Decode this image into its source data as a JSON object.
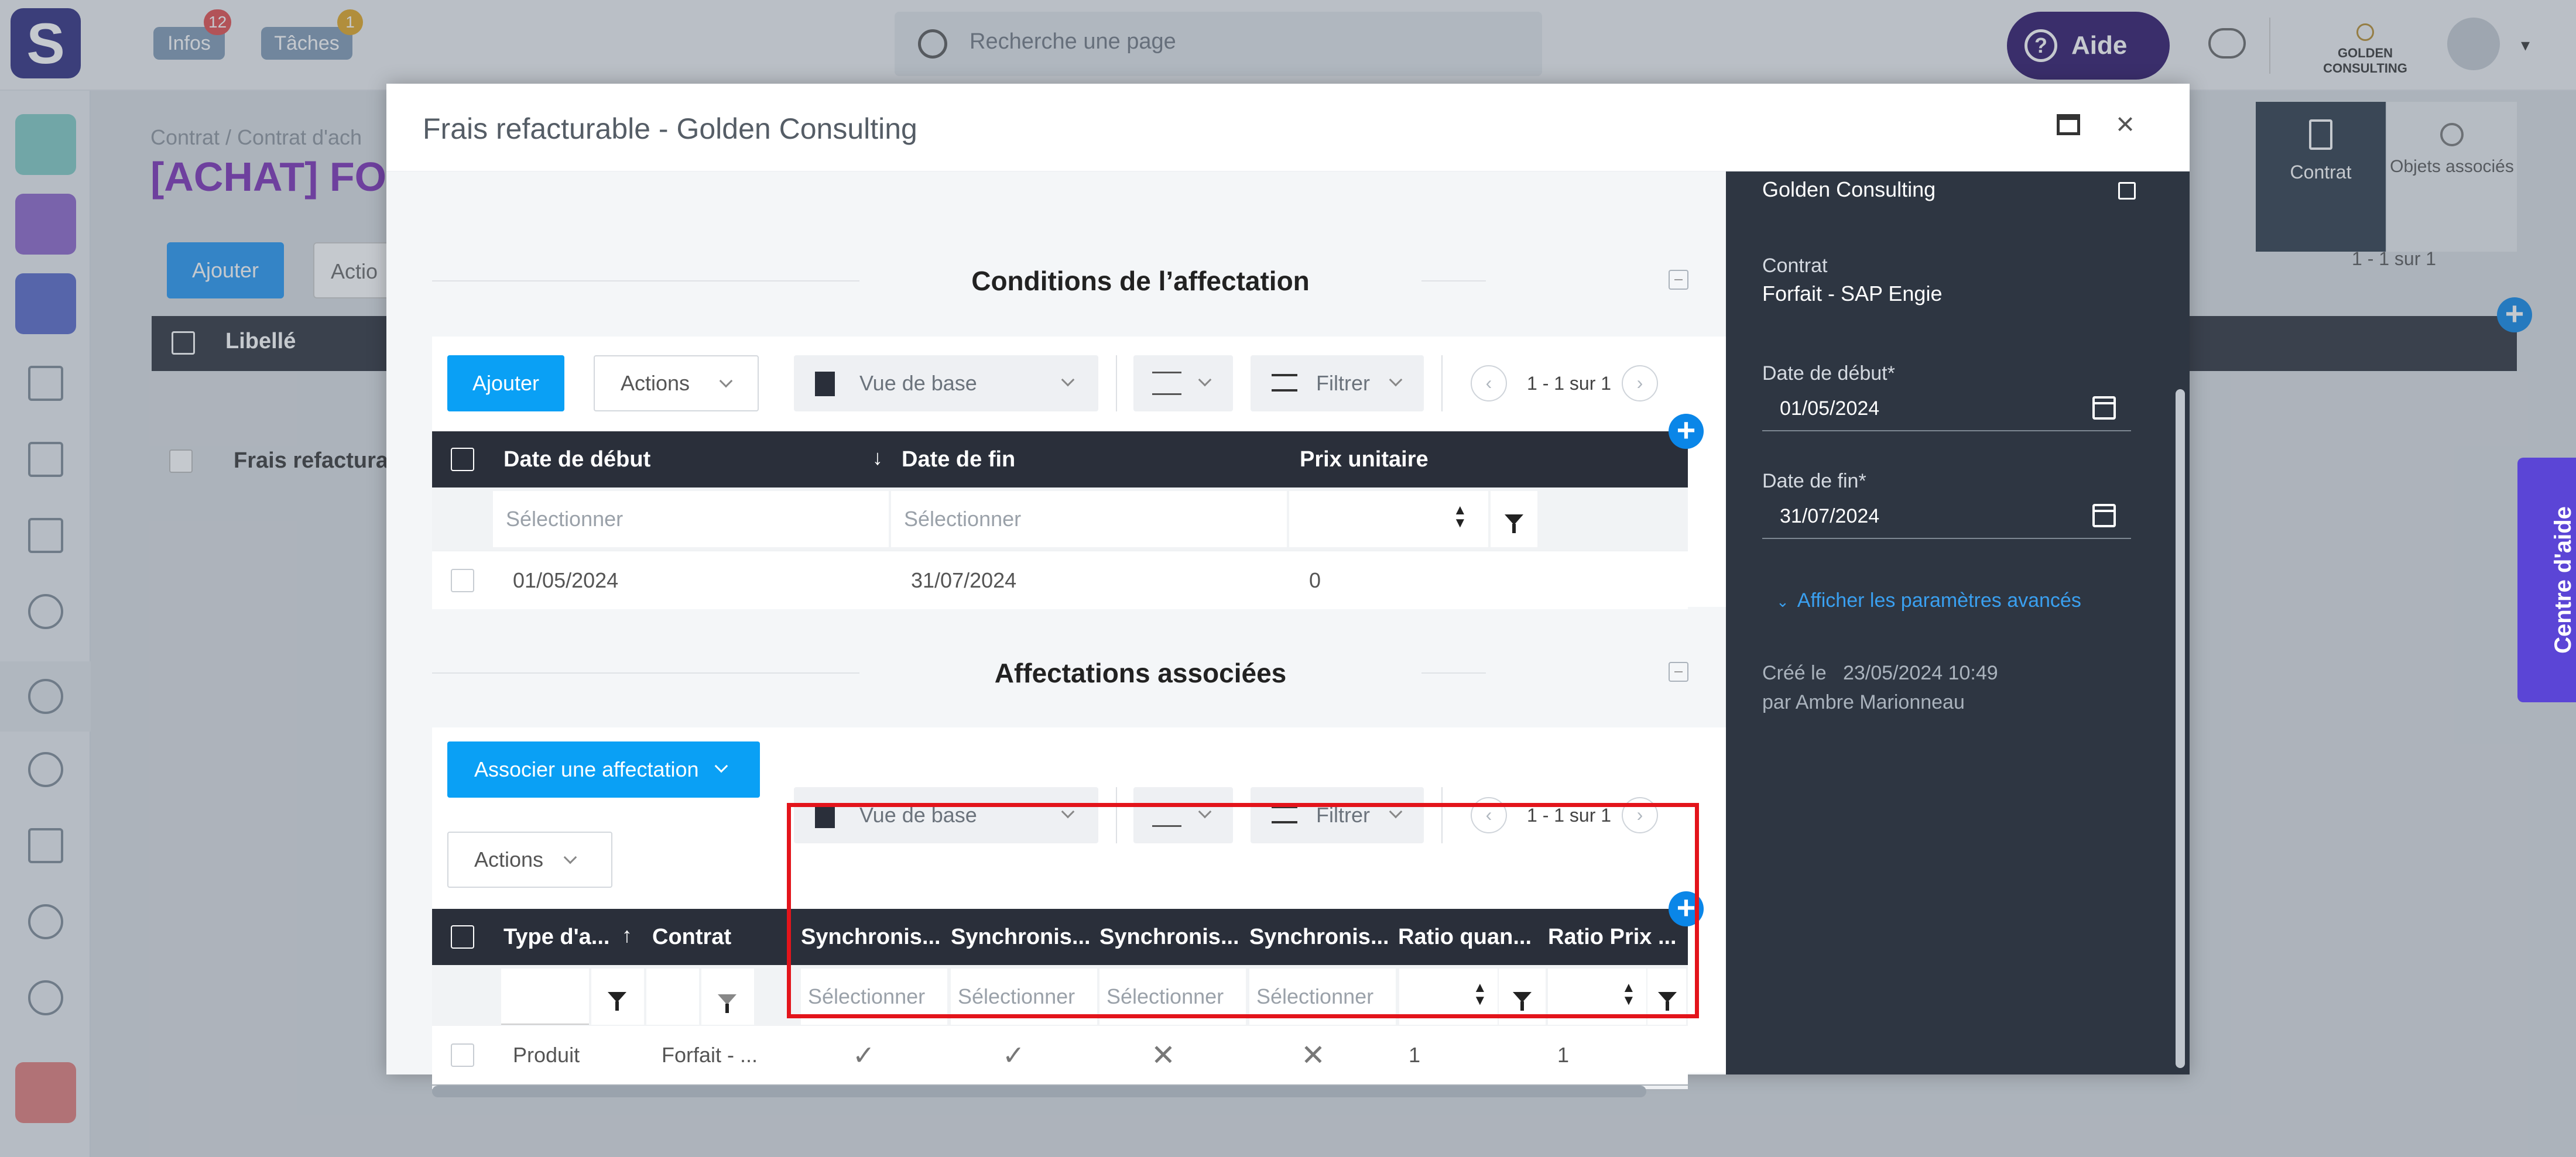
{
  "topbar": {
    "logo_letter": "S",
    "infos_label": "Infos",
    "infos_count": "12",
    "taches_label": "Tâches",
    "taches_count": "1",
    "search_placeholder": "Recherche une page",
    "aide_label": "Aide",
    "company_name": "GOLDEN CONSULTING",
    "colors": {
      "aide_bg": "#2a1168",
      "logo_bg": "#2b2a7e",
      "badge_red": "#e24a4a",
      "badge_yellow": "#e0a520"
    }
  },
  "background": {
    "breadcrumb": "Contrat  /  Contrat d'ach",
    "page_title": "[ACHAT] FO",
    "add_button": "Ajouter",
    "actions_button": "Actio",
    "col_label": "Libellé",
    "row_label": "Frais refacturab",
    "tab_contrat": "Contrat",
    "tab_objets": "Objets associés",
    "pager": "1 - 1 sur 1"
  },
  "modal": {
    "title": "Frais refacturable - Golden Consulting",
    "section1": {
      "title": "Conditions de l’affectation",
      "add_button": "Ajouter",
      "actions_button": "Actions",
      "view_label": "Vue de base",
      "filter_label": "Filtrer",
      "pager": "1 - 1 sur 1",
      "columns": [
        "Date de début",
        "Date de fin",
        "Prix unitaire"
      ],
      "filter_placeholder": "Sélectionner",
      "rows": [
        {
          "start": "01/05/2024",
          "end": "31/07/2024",
          "price": "0"
        }
      ]
    },
    "section2": {
      "title": "Affectations associées",
      "associate_button": "Associer une affectation",
      "actions_button": "Actions",
      "view_label": "Vue de base",
      "filter_label": "Filtrer",
      "pager": "1 - 1 sur 1",
      "columns": [
        "Type d'a...",
        "Contrat",
        "Synchronis...",
        "Synchronis...",
        "Synchronis...",
        "Synchronis...",
        "Ratio quan...",
        "Ratio Prix ..."
      ],
      "filter_placeholder": "Sélectionner",
      "rows": [
        {
          "type": "Produit",
          "contrat": "Forfait - ...",
          "sync1": "check",
          "sync2": "check",
          "sync3": "cross",
          "sync4": "cross",
          "ratio_qty": "1",
          "ratio_price": "1"
        }
      ]
    },
    "side_panel": {
      "company": "Golden Consulting",
      "contrat_label": "Contrat",
      "contrat_value": "Forfait - SAP Engie",
      "start_label": "Date de début*",
      "start_value": "01/05/2024",
      "end_label": "Date de fin*",
      "end_value": "31/07/2024",
      "advanced_link": "Afficher les paramètres avancés",
      "created_line": "Créé le   23/05/2024 10:49",
      "created_by": "par Ambre Marionneau"
    }
  },
  "help_tab": {
    "label": "Centre d'aide",
    "color": "#5b45d6"
  },
  "highlight": {
    "color": "#e3141b"
  }
}
